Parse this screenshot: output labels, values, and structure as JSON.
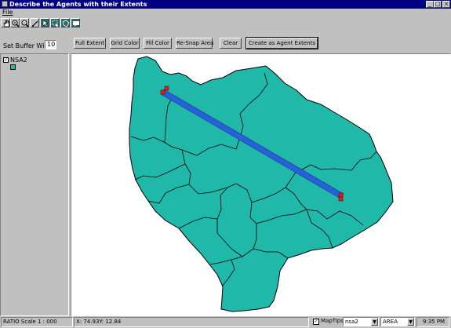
{
  "window": {
    "title": "Describe the Agents with their Extents",
    "minimize_glyph": "_",
    "maximize_glyph": "□",
    "close_glyph": "×"
  },
  "menu": {
    "file": "File"
  },
  "toolbar": {
    "tools": [
      "pan-hand-icon",
      "zoom-in-icon",
      "zoom-out-icon",
      "identify-icon",
      "select-arrow-icon",
      "select-box-icon",
      "select-polygon-icon",
      "map-tip-icon"
    ]
  },
  "commands": {
    "buffer_label": "Set Buffer Width",
    "buffer_value": "10",
    "full_extent": "Full Extent",
    "grid_color": "Grid Color",
    "fill_color": "Fill Color",
    "resnap_area": "Re-Snap Area",
    "clear": "Clear",
    "create_agent_extents": "Create as Agent Extents"
  },
  "legend": {
    "layer_name": "NSA2",
    "checked": true,
    "check_glyph": "✓",
    "swatch_color": "#20b8a8"
  },
  "map": {
    "polygon_fill": "#20b8a8",
    "polygon_stroke": "#000000",
    "line_color": "#2860d8",
    "vertex_color": "#e02020"
  },
  "status": {
    "scale": "RATIO Scale 1 : 000",
    "coords": "X: 74.93Y: 12.84",
    "maptips_label": "MapTips",
    "maptips_checked": true,
    "layer_select": "nsa2",
    "field_select": "AREA",
    "time": "9:35 PM"
  }
}
